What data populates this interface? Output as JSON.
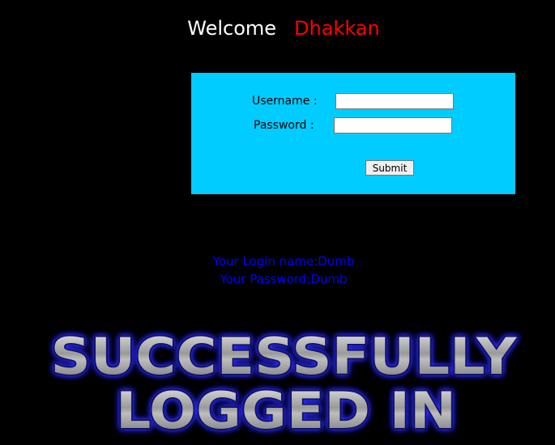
{
  "header": {
    "welcome_label": "Welcome",
    "user_name": "Dhakkan"
  },
  "login_form": {
    "username_label": "Username :",
    "username_value": "",
    "password_label": "Password :",
    "password_value": "",
    "submit_label": "Submit"
  },
  "result": {
    "login_name_line": "Your Login name:Dumb",
    "password_line": "Your Password:Dumb"
  },
  "banner": {
    "line1": "SUCCESSFULLY",
    "line2": "LOGGED IN"
  },
  "colors": {
    "background": "#000000",
    "form_background": "#00ccff",
    "user_name": "#ff0000",
    "result_text": "#0000ff",
    "banner_glow": "#3030ff"
  }
}
